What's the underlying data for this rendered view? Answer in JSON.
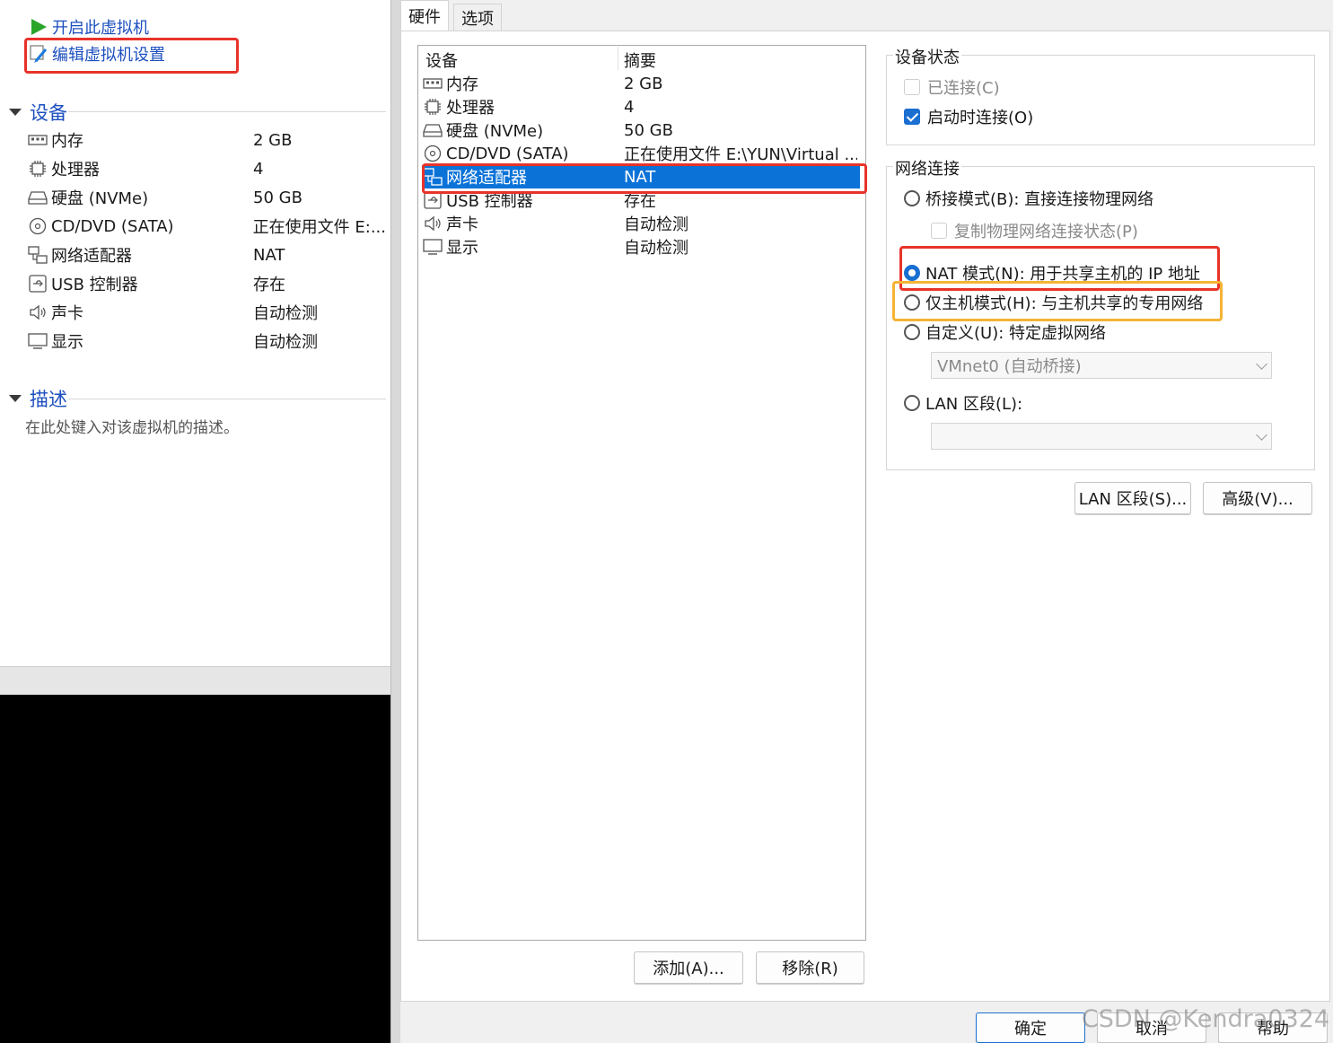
{
  "left_panel": {
    "actions": {
      "power_on": "开启此虚拟机",
      "edit_settings": "编辑虚拟机设置"
    },
    "devices_section": {
      "title": "设备",
      "items": [
        {
          "name": "内存",
          "value": "2 GB",
          "icon": "memory-icon"
        },
        {
          "name": "处理器",
          "value": "4",
          "icon": "processor-icon"
        },
        {
          "name": "硬盘 (NVMe)",
          "value": "50 GB",
          "icon": "hard-disk-icon"
        },
        {
          "name": "CD/DVD (SATA)",
          "value": "正在使用文件 E:...",
          "icon": "cd-dvd-icon"
        },
        {
          "name": "网络适配器",
          "value": "NAT",
          "icon": "network-adapter-icon"
        },
        {
          "name": "USB 控制器",
          "value": "存在",
          "icon": "usb-icon"
        },
        {
          "name": "声卡",
          "value": "自动检测",
          "icon": "sound-card-icon"
        },
        {
          "name": "显示",
          "value": "自动检测",
          "icon": "display-icon"
        }
      ]
    },
    "description_section": {
      "title": "描述",
      "placeholder": "在此处键入对该虚拟机的描述。"
    }
  },
  "dialog": {
    "tabs": [
      {
        "label": "硬件",
        "active": true
      },
      {
        "label": "选项",
        "active": false
      }
    ],
    "device_list": {
      "headers": {
        "device": "设备",
        "summary": "摘要"
      },
      "rows": [
        {
          "device": "内存",
          "summary": "2 GB",
          "icon": "memory-icon"
        },
        {
          "device": "处理器",
          "summary": "4",
          "icon": "processor-icon"
        },
        {
          "device": "硬盘 (NVMe)",
          "summary": "50 GB",
          "icon": "hard-disk-icon"
        },
        {
          "device": "CD/DVD (SATA)",
          "summary": "正在使用文件 E:\\YUN\\Virtual ...",
          "icon": "cd-dvd-icon"
        },
        {
          "device": "网络适配器",
          "summary": "NAT",
          "icon": "network-adapter-icon",
          "selected": true
        },
        {
          "device": "USB 控制器",
          "summary": "存在",
          "icon": "usb-icon"
        },
        {
          "device": "声卡",
          "summary": "自动检测",
          "icon": "sound-card-icon"
        },
        {
          "device": "显示",
          "summary": "自动检测",
          "icon": "display-icon"
        }
      ]
    },
    "list_buttons": {
      "add": "添加(A)...",
      "remove": "移除(R)"
    },
    "device_status": {
      "title": "设备状态",
      "connected": {
        "label": "已连接(C)",
        "checked": false,
        "enabled": false
      },
      "connect_at_power_on": {
        "label": "启动时连接(O)",
        "checked": true,
        "enabled": true
      }
    },
    "network_connection": {
      "title": "网络连接",
      "options": {
        "bridged": {
          "label": "桥接模式(B): 直接连接物理网络",
          "selected": false
        },
        "replicate": {
          "label": "复制物理网络连接状态(P)",
          "checked": false,
          "enabled": false
        },
        "nat": {
          "label": "NAT 模式(N): 用于共享主机的 IP 地址",
          "selected": true
        },
        "host_only": {
          "label": "仅主机模式(H): 与主机共享的专用网络",
          "selected": false
        },
        "custom": {
          "label": "自定义(U): 特定虚拟网络",
          "selected": false
        },
        "lan_segment": {
          "label": "LAN 区段(L):",
          "selected": false
        }
      },
      "custom_combo_value": "VMnet0 (自动桥接)",
      "lan_combo_value": ""
    },
    "network_buttons": {
      "lan_segments": "LAN 区段(S)...",
      "advanced": "高级(V)..."
    },
    "footer_buttons": {
      "ok": "确定",
      "cancel": "取消",
      "help": "帮助"
    }
  },
  "watermark": "CSDN @Kendra0324",
  "colors": {
    "link_blue": "#1c4fbf",
    "selection_blue": "#0b73d8",
    "highlight_red": "#e8332a",
    "highlight_orange": "#f5b335"
  }
}
